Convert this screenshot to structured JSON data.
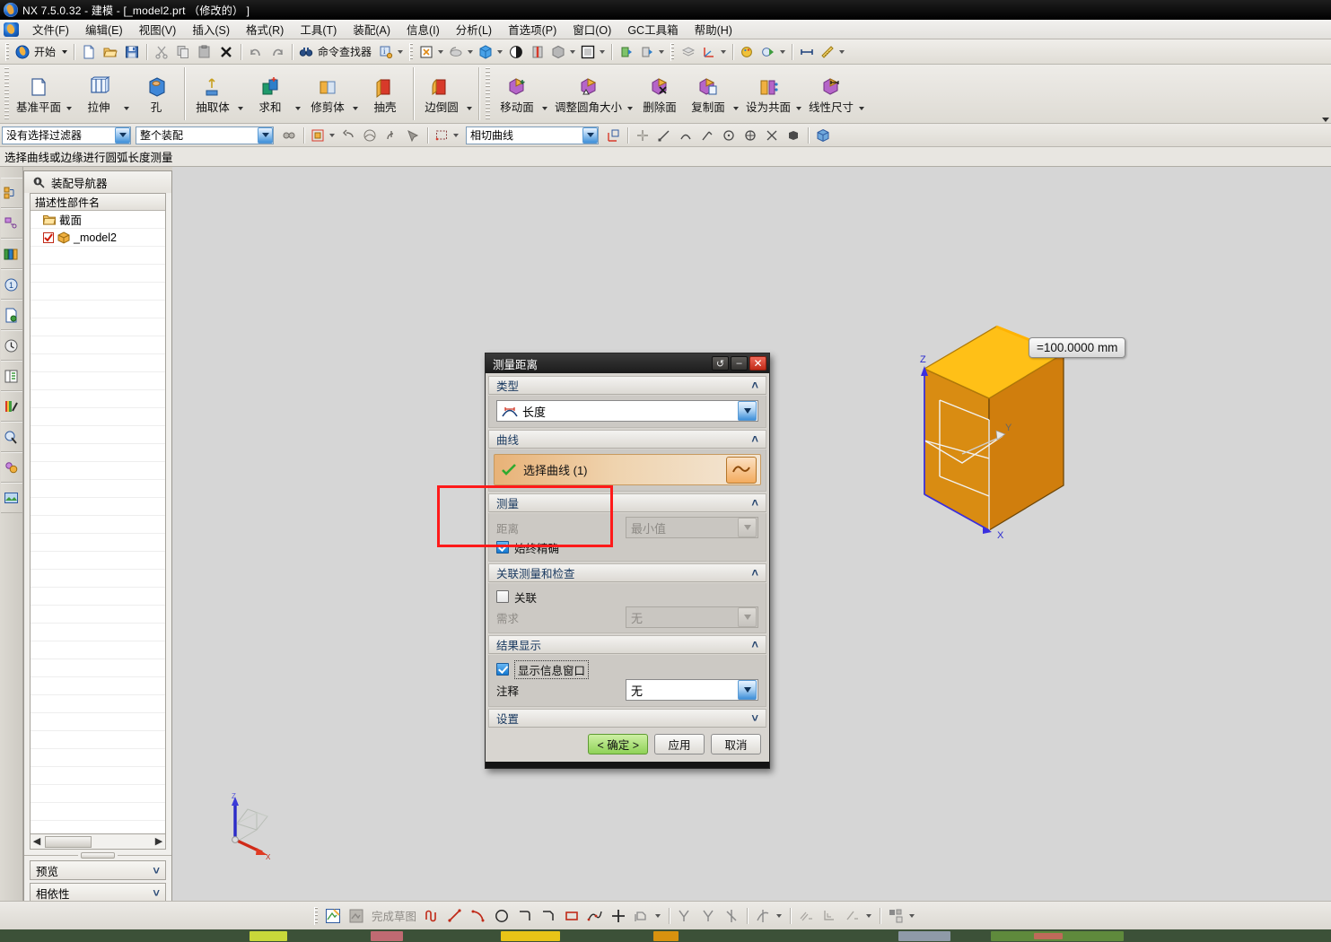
{
  "window": {
    "title": "NX 7.5.0.32 - 建模 - [_model2.prt  （修改的）  ]",
    "app_icon": "nx-logo-icon"
  },
  "menubar": {
    "items": [
      {
        "label": "文件(F)"
      },
      {
        "label": "编辑(E)"
      },
      {
        "label": "视图(V)"
      },
      {
        "label": "插入(S)"
      },
      {
        "label": "格式(R)"
      },
      {
        "label": "工具(T)"
      },
      {
        "label": "装配(A)"
      },
      {
        "label": "信息(I)"
      },
      {
        "label": "分析(L)"
      },
      {
        "label": "首选项(P)"
      },
      {
        "label": "窗口(O)"
      },
      {
        "label": "GC工具箱"
      },
      {
        "label": "帮助(H)"
      }
    ]
  },
  "standard_toolbar": {
    "start_label": "开始",
    "command_finder_label": "命令查找器",
    "buttons": [
      {
        "name": "new-file-button",
        "icon": "new-document-icon"
      },
      {
        "name": "open-file-button",
        "icon": "open-folder-icon"
      },
      {
        "name": "save-button",
        "icon": "floppy-disk-icon"
      },
      {
        "name": "cut-button",
        "icon": "scissors-icon"
      },
      {
        "name": "copy-button",
        "icon": "copy-icon"
      },
      {
        "name": "paste-button",
        "icon": "paste-icon"
      },
      {
        "name": "delete-button",
        "icon": "delete-x-icon"
      },
      {
        "name": "undo-button",
        "icon": "undo-arrow-icon"
      },
      {
        "name": "redo-button",
        "icon": "redo-arrow-icon"
      }
    ]
  },
  "ribbon": {
    "groups": [
      {
        "name": "feature-group",
        "items": [
          {
            "label": "基准平面",
            "icon": "datum-plane-icon",
            "has_dropdown": true
          },
          {
            "label": "拉伸",
            "icon": "extrude-icon",
            "has_dropdown": true
          },
          {
            "label": "孔",
            "icon": "hole-icon",
            "has_dropdown": false
          }
        ]
      },
      {
        "name": "body-group",
        "items": [
          {
            "label": "抽取体",
            "icon": "extract-body-icon",
            "has_dropdown": true
          },
          {
            "label": "求和",
            "icon": "unite-icon",
            "has_dropdown": true
          },
          {
            "label": "修剪体",
            "icon": "trim-body-icon",
            "has_dropdown": true
          },
          {
            "label": "抽壳",
            "icon": "shell-icon",
            "has_dropdown": false
          }
        ]
      },
      {
        "name": "edge-group",
        "items": [
          {
            "label": "边倒圆",
            "icon": "edge-blend-icon",
            "has_dropdown": true
          }
        ]
      },
      {
        "name": "synchronous-group",
        "items": [
          {
            "label": "移动面",
            "icon": "move-face-icon",
            "has_dropdown": true
          },
          {
            "label": "调整圆角大小",
            "icon": "resize-blend-icon",
            "has_dropdown": true
          },
          {
            "label": "删除面",
            "icon": "delete-face-icon",
            "has_dropdown": false
          },
          {
            "label": "复制面",
            "icon": "copy-face-icon",
            "has_dropdown": true
          },
          {
            "label": "设为共面",
            "icon": "make-coplanar-icon",
            "has_dropdown": true
          },
          {
            "label": "线性尺寸",
            "icon": "linear-dimension-icon",
            "has_dropdown": true
          }
        ]
      }
    ]
  },
  "selection_bar": {
    "filter_value": "没有选择过滤器",
    "scope_value": "整个装配",
    "curve_rule_value": "相切曲线",
    "icons": [
      {
        "name": "find-object-icon"
      },
      {
        "name": "selection-priority-icon"
      },
      {
        "name": "back-arrow-icon"
      },
      {
        "name": "highlight-shaded-icon"
      },
      {
        "name": "snap-point-icon"
      },
      {
        "name": "select-feature-icon"
      },
      {
        "name": "rectangle-select-icon"
      },
      {
        "name": "wcs-icon"
      },
      {
        "name": "point-snap-icon"
      },
      {
        "name": "line-snap-icon"
      },
      {
        "name": "arc-snap-icon"
      },
      {
        "name": "endpoint-snap-icon"
      },
      {
        "name": "center-snap-icon"
      },
      {
        "name": "quadrant-snap-icon"
      },
      {
        "name": "intersection-snap-icon"
      },
      {
        "name": "face-snap-icon"
      },
      {
        "name": "solid-body-icon"
      }
    ]
  },
  "cue_line": {
    "text": "选择曲线或边缘进行圆弧长度测量"
  },
  "resource_bar": {
    "items": [
      {
        "name": "assembly-navigator-icon"
      },
      {
        "name": "constraint-navigator-icon"
      },
      {
        "name": "part-navigator-icon"
      },
      {
        "name": "reuse-library-icon"
      },
      {
        "name": "html-help-icon"
      },
      {
        "name": "history-icon"
      },
      {
        "name": "roles-icon"
      },
      {
        "name": "system-scene-icon"
      },
      {
        "name": "web-browser-icon"
      },
      {
        "name": "integrated-gc-icon"
      },
      {
        "name": "image-preview-icon"
      }
    ]
  },
  "assembly_navigator": {
    "title": "装配导航器",
    "column_header": "描述性部件名",
    "rows": [
      {
        "label": "截面",
        "icon": "folder-icon",
        "has_checkbox": false
      },
      {
        "label": "_model2",
        "icon": "part-cube-icon",
        "has_checkbox": true,
        "checked": true
      }
    ],
    "collapsed_panels": [
      {
        "label": "预览"
      },
      {
        "label": "相依性"
      }
    ]
  },
  "viewport": {
    "measure_label": "=100.0000 mm",
    "triad_axes": [
      "Z",
      "Y",
      "X"
    ],
    "wcs_axes": [
      "Z",
      "X"
    ],
    "model_color": "#e08a14",
    "top_face_color": "#ffc017"
  },
  "dialog": {
    "title": "测量距离",
    "window_buttons": [
      {
        "name": "dialog-reset-button",
        "glyph": "↺"
      },
      {
        "name": "dialog-minimize-button",
        "glyph": "–"
      },
      {
        "name": "dialog-close-button",
        "glyph": "✕"
      }
    ],
    "sections": [
      {
        "header": "类型",
        "expanded": true
      },
      {
        "header": "曲线",
        "expanded": true
      },
      {
        "header": "测量",
        "expanded": true
      },
      {
        "header": "关联测量和检查",
        "expanded": true
      },
      {
        "header": "结果显示",
        "expanded": true
      },
      {
        "header": "设置",
        "expanded": false
      }
    ],
    "type_value": "长度",
    "type_icon": "arc-length-icon",
    "curve_select": {
      "label": "选择曲线 (1)",
      "check_icon": "green-check-icon",
      "action_icon": "curve-wave-icon"
    },
    "measure": {
      "distance_label": "距离",
      "distance_value": "最小值",
      "distance_disabled": true,
      "always_accurate_label": "始终精确",
      "always_accurate_checked": true
    },
    "associative": {
      "associative_label": "关联",
      "associative_checked": false,
      "requirement_label": "需求",
      "requirement_value": "无",
      "requirement_disabled": true
    },
    "result_display": {
      "show_info_window_label": "显示信息窗口",
      "show_info_window_checked": true,
      "annotation_label": "注释",
      "annotation_value": "无"
    },
    "footer_buttons": [
      {
        "label": "< 确定 >",
        "name": "ok-button",
        "primary": true
      },
      {
        "label": "应用",
        "name": "apply-button",
        "primary": false
      },
      {
        "label": "取消",
        "name": "cancel-button",
        "primary": false
      }
    ]
  },
  "sketch_toolbar": {
    "finish_sketch_label": "完成草图",
    "buttons": [
      {
        "name": "sketch-in-task-icon"
      },
      {
        "name": "finish-sketch-icon"
      },
      {
        "name": "profile-icon"
      },
      {
        "name": "line-icon"
      },
      {
        "name": "arc-icon"
      },
      {
        "name": "circle-icon"
      },
      {
        "name": "fillet-icon"
      },
      {
        "name": "chamfer-icon"
      },
      {
        "name": "rectangle-icon"
      },
      {
        "name": "polygon-studio-spline-icon"
      },
      {
        "name": "point-icon"
      },
      {
        "name": "offset-curve-icon"
      },
      {
        "name": "quick-trim-icon"
      },
      {
        "name": "quick-extend-icon"
      },
      {
        "name": "make-corner-icon"
      },
      {
        "name": "mirror-curve-icon"
      },
      {
        "name": "geometric-constraint-icon"
      },
      {
        "name": "alternate-solution-icon"
      },
      {
        "name": "auto-constrain-icon"
      },
      {
        "name": "display-constraints-icon"
      }
    ]
  },
  "highlight": {
    "color": "#ff1a1a",
    "target": "result-display-section"
  },
  "colors": {
    "accent_blue": "#17375e",
    "selection_orange": "#e8b277",
    "ok_green": "#8fd257",
    "title_black": "#000000"
  }
}
